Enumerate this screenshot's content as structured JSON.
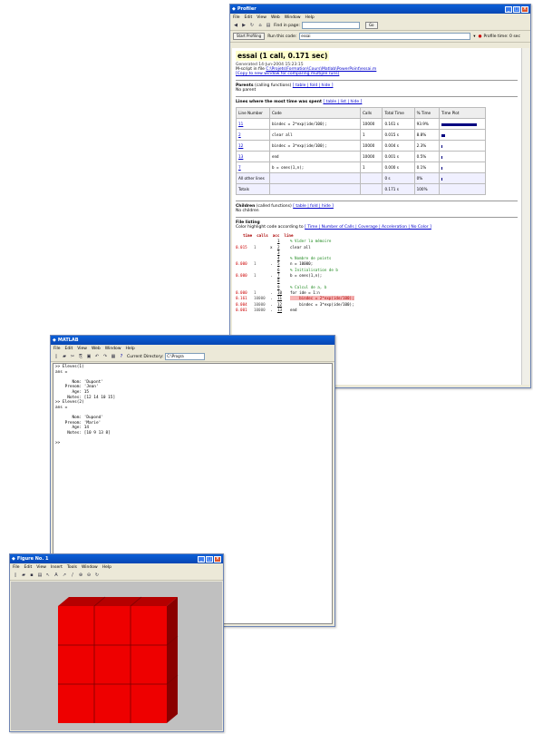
{
  "profiler": {
    "title": "Profiler",
    "menu": [
      "File",
      "Edit",
      "View",
      "Web",
      "Window",
      "Help"
    ],
    "find_label": "Find in page:",
    "go_label": "Go",
    "start_button": "Start Profiling",
    "run_label": "Run this code:",
    "run_value": "essai",
    "profile_time": "Profile time: 0 sec",
    "heading": "essai (1 call, 0.171 sec)",
    "generated": "Generated 14-Jun-2004 15:23:15",
    "mscript": "M-script in file",
    "file_path": "C:\\Projets\\Formation\\Cours\\Matlab\\PowerPoint\\essai.m",
    "copy_link": "[Copy to new window for comparing multiple runs]",
    "parents_title": "Parents",
    "parents_sub": "(calling functions)",
    "parents_links": "[ table | fold | hide ]",
    "no_parent": "No parent",
    "lines_title": "Lines where the most time was spent",
    "lines_links": "[ table | list | hide ]",
    "columns": [
      "Line Number",
      "Code",
      "Calls",
      "Total Time",
      "% Time",
      "Time Plot"
    ],
    "rows": [
      {
        "line": "11",
        "code": "bindec = 2*exp(ide/100);",
        "calls": "10000",
        "total": "0.161 s",
        "pct": "93.9%",
        "frac": 0.939
      },
      {
        "line": "2",
        "code": "clear all",
        "calls": "1",
        "total": "0.015 s",
        "pct": "8.8%",
        "frac": 0.088
      },
      {
        "line": "12",
        "code": "bindec = 3*exp(ide/100);",
        "calls": "10000",
        "total": "0.004 s",
        "pct": "2.3%",
        "frac": 0.023
      },
      {
        "line": "13",
        "code": "end",
        "calls": "10000",
        "total": "0.001 s",
        "pct": "0.5%",
        "frac": 0.005
      },
      {
        "line": "7",
        "code": "b = ones(1,n);",
        "calls": "1",
        "total": "0.000 s",
        "pct": "0.1%",
        "frac": 0.001
      }
    ],
    "other_lines": {
      "label": "All other lines",
      "total": "0 s",
      "pct": "0%",
      "frac": 0.02
    },
    "totals": {
      "label": "Totals",
      "total": "0.171 s",
      "pct": "100%"
    },
    "children_title": "Children",
    "children_sub": "(called functions)",
    "children_links": "[ table | fold | hide ]",
    "no_children": "No children",
    "listing_title": "File listing",
    "color_label": "Color highlight code according to",
    "color_links": "[ Time | Number of Calls | Coverage | Acceleration | No Color ]",
    "code_header": "time  calls  acc  line",
    "code_lines": [
      {
        "time": "",
        "calls": "",
        "acc": "",
        "num": "1",
        "text": "% Vider la mémoire",
        "kind": "cmt"
      },
      {
        "time": "0.015",
        "calls": "1",
        "acc": "x",
        "num": "2",
        "text": "clear all",
        "kind": "code"
      },
      {
        "time": "",
        "calls": "",
        "acc": "",
        "num": "3",
        "text": "",
        "kind": "code"
      },
      {
        "time": "",
        "calls": "",
        "acc": "",
        "num": "4",
        "text": "% Nombre de points",
        "kind": "cmt"
      },
      {
        "time": "0.000",
        "calls": "1",
        "acc": ".",
        "num": "5",
        "text": "n = 10000;",
        "kind": "code"
      },
      {
        "time": "",
        "calls": "",
        "acc": "",
        "num": "6",
        "text": "% Initialisation de b",
        "kind": "cmt"
      },
      {
        "time": "0.000",
        "calls": "1",
        "acc": ".",
        "num": "7",
        "text": "b = ones(1,n);",
        "kind": "code"
      },
      {
        "time": "",
        "calls": "",
        "acc": "",
        "num": "8",
        "text": "",
        "kind": "code"
      },
      {
        "time": "",
        "calls": "",
        "acc": "",
        "num": "9",
        "text": "% Calcul de a, b",
        "kind": "cmt"
      },
      {
        "time": "0.000",
        "calls": "1",
        "acc": ".",
        "num": "10",
        "text": "for ide = 1:n",
        "kind": "code"
      },
      {
        "time": "0.161",
        "calls": "10000",
        "acc": ".",
        "num": "11",
        "text": "    bindec = 2*exp(ide/100);",
        "kind": "hot"
      },
      {
        "time": "0.004",
        "calls": "10000",
        "acc": ".",
        "num": "12",
        "text": "    bindec = 3*exp(ide/100);",
        "kind": "code"
      },
      {
        "time": "0.001",
        "calls": "10000",
        "acc": ".",
        "num": "13",
        "text": "end",
        "kind": "code"
      }
    ]
  },
  "matlab": {
    "title": "MATLAB",
    "menu": [
      "File",
      "Edit",
      "View",
      "Web",
      "Window",
      "Help"
    ],
    "current_dir_label": "Current Directory:",
    "current_dir_value": "C:\\Progra",
    "lines": [
      ">> Eleves(1)",
      "ans =",
      "",
      "       Nom: 'Dupont'",
      "    Prenom: 'Jean'",
      "       Age: 15",
      "     Notes: [12 14 10 15]",
      ">> Eleves(2)",
      "ans =",
      "",
      "       Nom: 'Dupond'",
      "    Prenom: 'Marie'",
      "       Age: 14",
      "     Notes: [10 9 13 8]",
      "",
      ">>"
    ]
  },
  "figure": {
    "title": "Figure No. 1",
    "menu": [
      "File",
      "Edit",
      "View",
      "Insert",
      "Tools",
      "Window",
      "Help"
    ]
  },
  "colors": {
    "cube_front": "#ee0000",
    "cube_top": "#b50000",
    "cube_side": "#8a0000",
    "title_blue": "#0a5fd8"
  }
}
